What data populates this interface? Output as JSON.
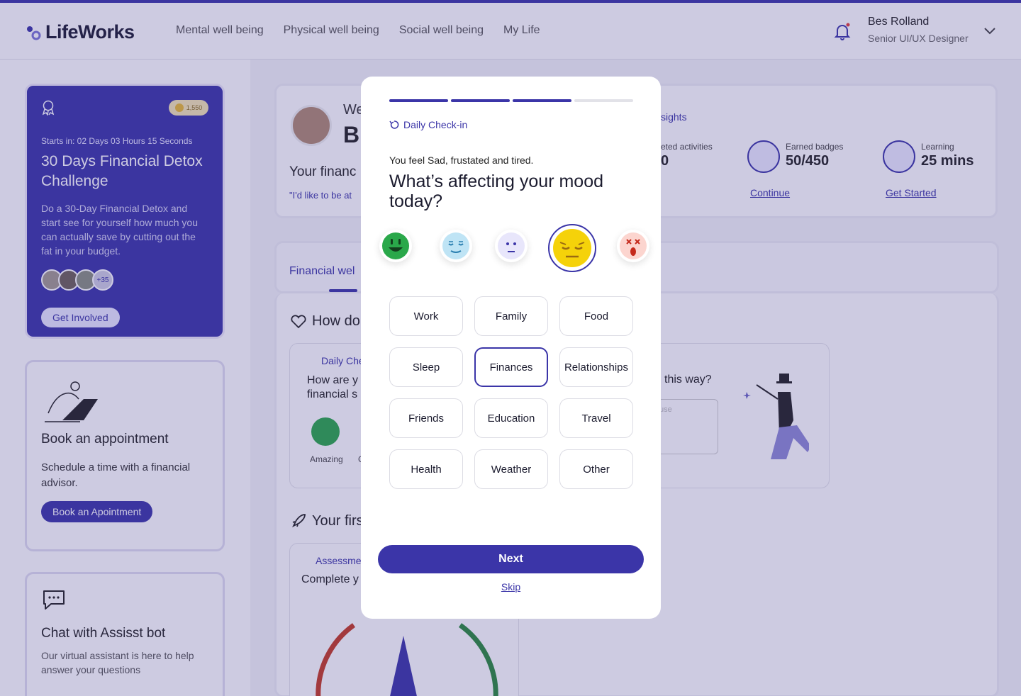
{
  "app": {
    "name": "LifeWorks"
  },
  "nav": [
    "Mental well being",
    "Physical well being",
    "Social well being",
    "My Life"
  ],
  "user": {
    "name": "Bes Rolland",
    "role": "Senior UI/UX Designer"
  },
  "challenge": {
    "coins": "1,550",
    "starts": "Starts in: 02 Days 03 Hours 15 Seconds",
    "title": "30 Days Financial Detox Challenge",
    "desc": "Do a 30-Day Financial Detox and start see for yourself how much you can actually save by cutting out the fat in your budget.",
    "more": "+35",
    "cta": "Get Involved"
  },
  "appointment": {
    "title": "Book an appointment",
    "desc": "Schedule a time with a financial advisor.",
    "cta": "Book an Apointment"
  },
  "chatbot": {
    "title": "Chat with Assisst bot",
    "desc": "Our virtual assistant is here to help answer your questions"
  },
  "background": {
    "welcome": "We",
    "name": "B",
    "your_finance": "Your financ",
    "quote": "\"I'd like to be at",
    "insights": "sights",
    "completed": "eted activities",
    "completed_value": "0",
    "badges_label": "Earned badges",
    "badges_value": "50/450",
    "learning_label": "Learning",
    "learning_value": "25 mins",
    "continue": "Continue",
    "get_started": "Get Started",
    "tab": "Financial wel",
    "how": "How do",
    "daily": "Daily Che",
    "card_q": "How are y",
    "card_q2": "financial s",
    "amazing": "Amazing",
    "g": "G",
    "this_way": "this way?",
    "placeholder": "use",
    "your_first": "Your firs",
    "assessment": "Assessmen",
    "complete": "Complete y"
  },
  "modal": {
    "progress_total": 4,
    "progress_done": 3,
    "checkin": "Daily Check-in",
    "feel": "You feel Sad, frustated and tired.",
    "question": "What’s affecting your mood today?",
    "moods": [
      "amazing",
      "calm",
      "neutral",
      "sad",
      "upset"
    ],
    "selected_mood": "sad",
    "options": [
      "Work",
      "Family",
      "Food",
      "Sleep",
      "Finances",
      "Relationships",
      "Friends",
      "Education",
      "Travel",
      "Health",
      "Weather",
      "Other"
    ],
    "selected_option": "Finances",
    "next": "Next",
    "skip": "Skip"
  },
  "colors": {
    "primary": "#3b35a8",
    "coin": "#e9b932",
    "mood_sad": "#f5d20a"
  }
}
